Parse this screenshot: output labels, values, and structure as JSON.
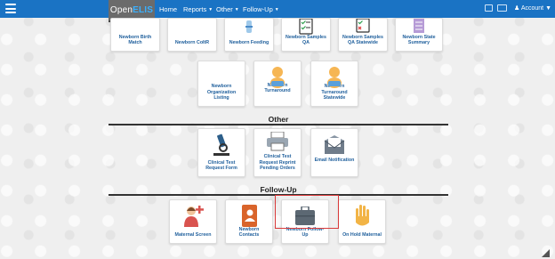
{
  "nav": {
    "logo_open": "Open",
    "logo_elis": "ELIS",
    "items": [
      {
        "label": "Home"
      },
      {
        "label": "Reports"
      },
      {
        "label": "Other"
      },
      {
        "label": "Follow-Up"
      }
    ],
    "account_label": "Account"
  },
  "tiles_top": [
    {
      "label": "Newborn Birth Match"
    },
    {
      "label": "Newborn CoItR"
    },
    {
      "label": "Newborn Feeding"
    },
    {
      "label": "Newborn Samples QA"
    },
    {
      "label": "Newborn Samples QA Statewide"
    },
    {
      "label": "Newborn State Summary"
    }
  ],
  "tiles_row2": [
    {
      "label": "Newborn Organization Listing"
    },
    {
      "label": "Newborn Turnaround"
    },
    {
      "label": "Newborn Turnaround Statewide"
    }
  ],
  "sections": {
    "other": "Other",
    "followup": "Follow-Up"
  },
  "tiles_other": [
    {
      "label": "Clinical Test Request Form"
    },
    {
      "label": "Clinical Test Request Reprint Pending Orders"
    },
    {
      "label": "Email Notification"
    }
  ],
  "tiles_followup": [
    {
      "label": "Maternal Screen"
    },
    {
      "label": "Newborn Contacts"
    },
    {
      "label": "Newborn Follow-Up"
    },
    {
      "label": "On Hold Maternal"
    }
  ],
  "colors": {
    "nav_blue": "#1a73c4",
    "tile_text": "#1f5f9c",
    "highlight": "#d93a3a"
  }
}
